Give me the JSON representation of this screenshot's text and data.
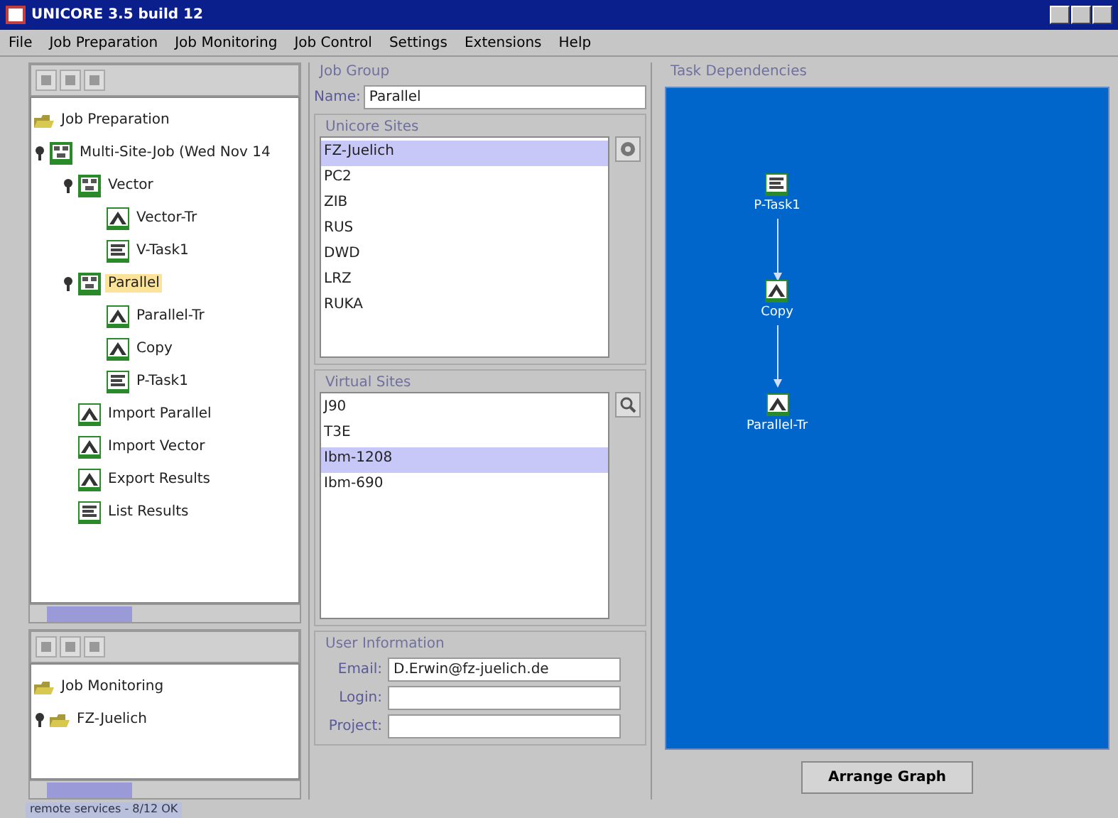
{
  "window": {
    "title": "UNICORE 3.5 build 12"
  },
  "menu": [
    "File",
    "Job Preparation",
    "Job Monitoring",
    "Job Control",
    "Settings",
    "Extensions",
    "Help"
  ],
  "job_tree": {
    "root": "Job Preparation",
    "items": [
      {
        "label": "Multi-Site-Job (Wed Nov 14",
        "kind": "group",
        "expanded": true,
        "selected": false,
        "children": [
          {
            "label": "Vector",
            "kind": "group",
            "expanded": true,
            "selected": false,
            "children": [
              {
                "label": "Vector-Tr",
                "kind": "task",
                "selected": false
              },
              {
                "label": "V-Task1",
                "kind": "script",
                "selected": false
              }
            ]
          },
          {
            "label": "Parallel",
            "kind": "group",
            "expanded": true,
            "selected": true,
            "children": [
              {
                "label": "Parallel-Tr",
                "kind": "task",
                "selected": false
              },
              {
                "label": "Copy",
                "kind": "task",
                "selected": false
              },
              {
                "label": "P-Task1",
                "kind": "script",
                "selected": false
              }
            ]
          },
          {
            "label": "Import Parallel",
            "kind": "task",
            "selected": false
          },
          {
            "label": "Import Vector",
            "kind": "task",
            "selected": false
          },
          {
            "label": "Export Results",
            "kind": "task",
            "selected": false
          },
          {
            "label": "List Results",
            "kind": "script",
            "selected": false
          }
        ]
      }
    ]
  },
  "monitor_tree": {
    "root": "Job Monitoring",
    "items": [
      {
        "label": "FZ-Juelich",
        "expanded": true
      }
    ]
  },
  "job_group": {
    "title": "Job Group",
    "name_label": "Name:",
    "name_value": "Parallel"
  },
  "unicore_sites": {
    "title": "Unicore Sites",
    "items": [
      {
        "label": "FZ-Juelich",
        "selected": true
      },
      {
        "label": "PC2",
        "selected": false
      },
      {
        "label": "ZIB",
        "selected": false
      },
      {
        "label": "RUS",
        "selected": false
      },
      {
        "label": "DWD",
        "selected": false
      },
      {
        "label": "LRZ",
        "selected": false
      },
      {
        "label": "RUKA",
        "selected": false
      }
    ]
  },
  "virtual_sites": {
    "title": "Virtual Sites",
    "items": [
      {
        "label": "J90",
        "selected": false
      },
      {
        "label": "T3E",
        "selected": false
      },
      {
        "label": "Ibm-1208",
        "selected": true
      },
      {
        "label": "Ibm-690",
        "selected": false
      }
    ]
  },
  "user_info": {
    "title": "User Information",
    "fields": [
      {
        "label": "Email:",
        "value": "D.Erwin@fz-juelich.de"
      },
      {
        "label": "Login:"
      },
      {
        "label": "Project:"
      }
    ]
  },
  "task_dependencies": {
    "title": "Task Dependencies",
    "nodes": [
      {
        "label": "P-Task1",
        "kind": "script"
      },
      {
        "label": "Copy",
        "kind": "task"
      },
      {
        "label": "Parallel-Tr",
        "kind": "task"
      }
    ],
    "button": "Arrange Graph"
  },
  "status_bar": "remote services - 8/12 OK"
}
